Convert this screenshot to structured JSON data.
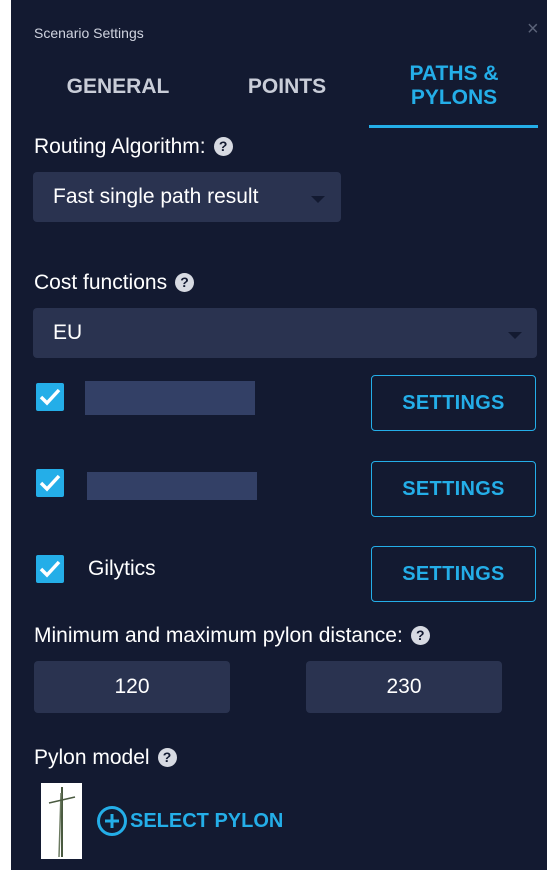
{
  "panel": {
    "title": "Scenario Settings",
    "close_icon": "×"
  },
  "tabs": [
    {
      "label": "GENERAL",
      "active": false
    },
    {
      "label": "POINTS",
      "active": false
    },
    {
      "label": "PATHS & PYLONS",
      "line1": "PATHS &",
      "line2": "PYLONS",
      "active": true
    }
  ],
  "routing": {
    "label": "Routing Algorithm:",
    "help": "?",
    "selected": "Fast single path result"
  },
  "cost": {
    "label": "Cost functions",
    "help": "?",
    "selected": "EU",
    "items": [
      {
        "label": "",
        "checked": true,
        "button": "SETTINGS"
      },
      {
        "label": "",
        "checked": true,
        "button": "SETTINGS"
      },
      {
        "label": "Gilytics",
        "checked": true,
        "button": "SETTINGS"
      }
    ]
  },
  "pylon_distance": {
    "label": "Minimum and maximum pylon distance:",
    "help": "?",
    "min": "120",
    "max": "230"
  },
  "pylon_model": {
    "label": "Pylon model",
    "help": "?",
    "select_label": "SELECT PYLON"
  },
  "colors": {
    "accent": "#24aee8",
    "panel_bg": "#131a31",
    "field_bg": "#2a3350"
  }
}
